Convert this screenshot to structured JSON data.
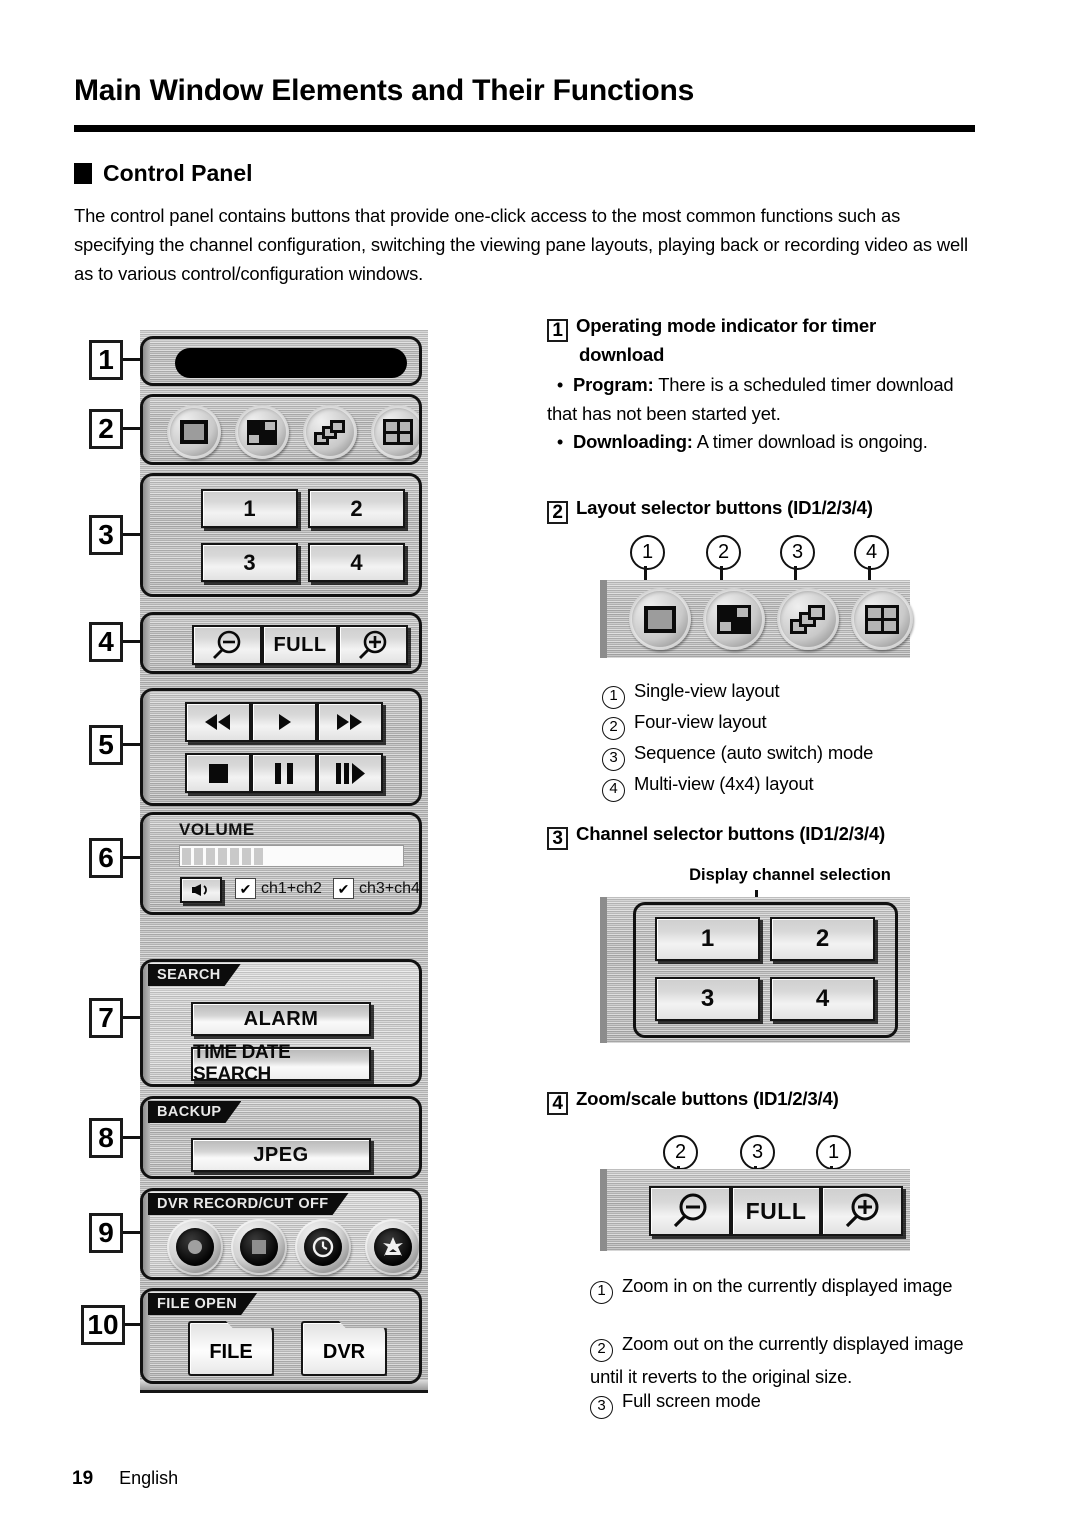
{
  "document": {
    "title": "Main Window Elements and Their Functions",
    "section_heading": "Control Panel",
    "intro": "The control panel contains buttons that provide one-click access to the most common functions such as specifying the channel configuration, switching the viewing pane layouts, playing back or recording video as well as to various control/configuration windows.",
    "page_number": "19",
    "language": "English"
  },
  "control_panel": {
    "callouts": [
      "1",
      "2",
      "3",
      "4",
      "5",
      "6",
      "7",
      "8",
      "9",
      "10"
    ],
    "indicator": {
      "label": ""
    },
    "layout_buttons": [
      {
        "icon": "single-view-icon"
      },
      {
        "icon": "four-view-icon"
      },
      {
        "icon": "sequence-icon"
      },
      {
        "icon": "multi-view-icon"
      }
    ],
    "channel_buttons": [
      "1",
      "2",
      "3",
      "4"
    ],
    "zoom_buttons": [
      {
        "label": "",
        "icon": "zoom-out-icon"
      },
      {
        "label": "FULL",
        "icon": ""
      },
      {
        "label": "",
        "icon": "zoom-in-icon"
      }
    ],
    "playback_buttons": [
      {
        "icon": "rewind-icon"
      },
      {
        "icon": "play-icon"
      },
      {
        "icon": "fast-forward-icon"
      },
      {
        "icon": "stop-icon"
      },
      {
        "icon": "pause-icon"
      },
      {
        "icon": "frame-advance-icon"
      }
    ],
    "volume": {
      "label": "VOLUME",
      "level_segments": 7,
      "total_segments": 19,
      "mute_icon": "speaker-icon",
      "checkboxes": [
        {
          "label": "ch1+ch2",
          "checked": true
        },
        {
          "label": "ch3+ch4",
          "checked": true
        }
      ]
    },
    "search": {
      "tab": "SEARCH",
      "buttons": [
        "ALARM",
        "TIME DATE SEARCH"
      ]
    },
    "backup": {
      "tab": "BACKUP",
      "buttons": [
        "JPEG"
      ]
    },
    "dvr_record": {
      "tab": "DVR RECORD/CUT OFF",
      "buttons": [
        {
          "icon": "record-icon"
        },
        {
          "icon": "stop-square-icon"
        },
        {
          "icon": "clock-icon"
        },
        {
          "icon": "cutoff-icon"
        }
      ]
    },
    "file_open": {
      "tab": "FILE OPEN",
      "buttons": [
        "FILE",
        "DVR"
      ]
    }
  },
  "descriptions": {
    "item1": {
      "number": "1",
      "title_line1": "Operating mode indicator for timer",
      "title_line2": "download",
      "bullets": [
        {
          "term": "Program:",
          "text": "There is a scheduled timer download that has not been started yet."
        },
        {
          "term": "Downloading:",
          "text": "A timer download is ongoing."
        }
      ]
    },
    "item2": {
      "number": "2",
      "title": "Layout selector buttons (ID1/2/3/4)",
      "callout_numbers": [
        "1",
        "2",
        "3",
        "4"
      ],
      "legend": [
        {
          "num": "1",
          "text": "Single-view layout"
        },
        {
          "num": "2",
          "text": "Four-view layout"
        },
        {
          "num": "3",
          "text": "Sequence (auto switch) mode"
        },
        {
          "num": "4",
          "text": "Multi-view (4x4) layout"
        }
      ]
    },
    "item3": {
      "number": "3",
      "title": "Channel selector buttons (ID1/2/3/4)",
      "annotation": "Display channel selection",
      "buttons": [
        "1",
        "2",
        "3",
        "4"
      ]
    },
    "item4": {
      "number": "4",
      "title": "Zoom/scale buttons (ID1/2/3/4)",
      "callout_numbers": [
        "2",
        "3",
        "1"
      ],
      "full_label": "FULL",
      "legend": [
        {
          "num": "1",
          "text": "Zoom in on the currently displayed image"
        },
        {
          "num": "2",
          "text": "Zoom out on the currently displayed image until it reverts to the original size."
        },
        {
          "num": "3",
          "text": "Full screen mode"
        }
      ]
    }
  },
  "colors": {
    "ink": "#000000",
    "panel_border": "#111111",
    "tab_bg": "#0c0c0c",
    "tab_fg": "#e9e9e9"
  }
}
